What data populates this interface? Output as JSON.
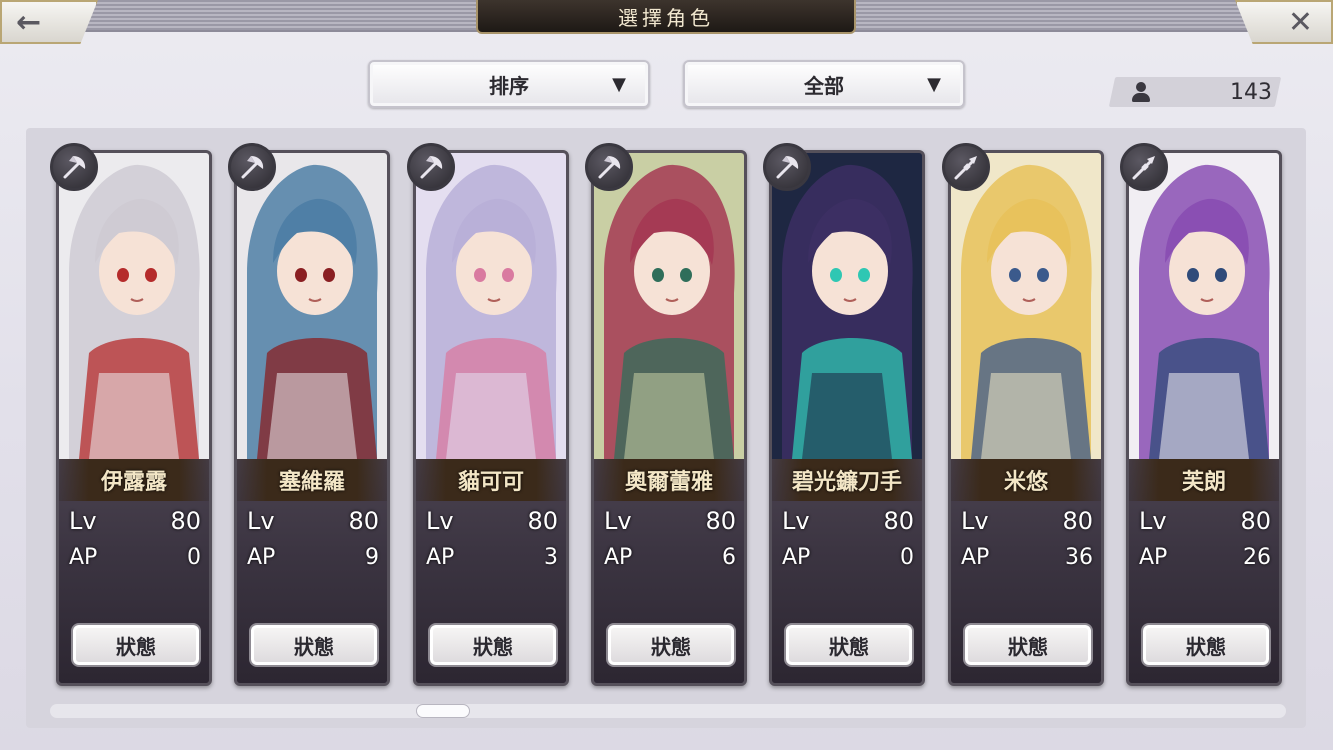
{
  "header": {
    "title": "選擇角色",
    "back_icon": "←",
    "close_icon": "✕"
  },
  "filters": {
    "sort_label": "排序",
    "filter_label": "全部",
    "caret": "▼"
  },
  "roster_count": "143",
  "status_label": "狀態",
  "lv_label": "Lv",
  "ap_label": "AP",
  "characters": [
    {
      "name": "伊露露",
      "lv": "80",
      "ap": "0",
      "weapon": "axe-icon",
      "palette": [
        "#ecebee",
        "#cfcbd3",
        "#b52b2b"
      ]
    },
    {
      "name": "塞維羅",
      "lv": "80",
      "ap": "9",
      "weapon": "axe-icon",
      "palette": [
        "#e9e7ea",
        "#4f7fa6",
        "#8a1f22"
      ]
    },
    {
      "name": "貓可可",
      "lv": "80",
      "ap": "3",
      "weapon": "axe-icon",
      "palette": [
        "#e4def0",
        "#b9b0d8",
        "#d97aa0"
      ]
    },
    {
      "name": "奧爾蕾雅",
      "lv": "80",
      "ap": "6",
      "weapon": "axe-icon",
      "palette": [
        "#c9cfa4",
        "#a53a54",
        "#2f6e5a"
      ]
    },
    {
      "name": "碧光鐮刀手",
      "lv": "80",
      "ap": "0",
      "weapon": "axe-icon",
      "palette": [
        "#1e2742",
        "#3c2f63",
        "#2fc7b3"
      ]
    },
    {
      "name": "米悠",
      "lv": "80",
      "ap": "36",
      "weapon": "spear-icon",
      "palette": [
        "#f0e7c9",
        "#e8c25c",
        "#3b5a8c"
      ]
    },
    {
      "name": "芙朗",
      "lv": "80",
      "ap": "26",
      "weapon": "spear-icon",
      "palette": [
        "#f1eef3",
        "#8a4fb3",
        "#2f4b7a"
      ]
    }
  ]
}
